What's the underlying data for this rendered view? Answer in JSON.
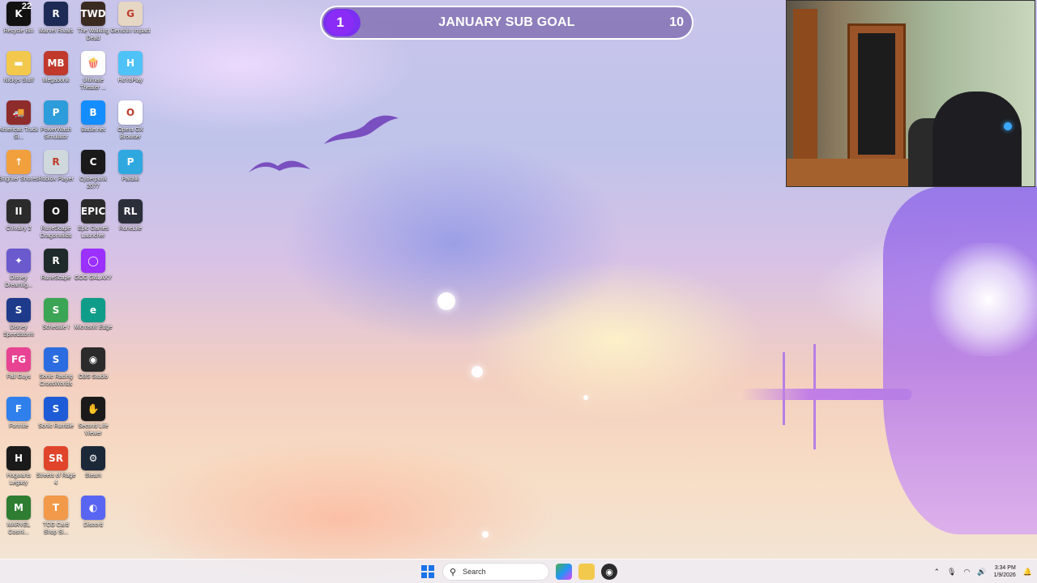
{
  "desktop": {
    "icons": [
      {
        "label": "Recycle Bin",
        "icon": "recycle-bin-icon",
        "glyph": "K",
        "badge": "22",
        "color": "#111111"
      },
      {
        "label": "Marvel Rivals",
        "icon": "marvel-rivals-icon",
        "glyph": "R",
        "color": "#1d2a55"
      },
      {
        "label": "The Walking Dead",
        "icon": "walking-dead-icon",
        "glyph": "TWD",
        "color": "#3b2a20"
      },
      {
        "label": "Genshin Impact",
        "icon": "genshin-impact-icon",
        "glyph": "G",
        "color": "#e6d7c4"
      },
      {
        "label": "Nickys Stuff",
        "icon": "folder-icon",
        "glyph": "▬",
        "color": "#f2c94c"
      },
      {
        "label": "Megabonk",
        "icon": "megabonk-icon",
        "glyph": "MB",
        "color": "#c0392b"
      },
      {
        "label": "Ultimate Theater ...",
        "icon": "popcorn-icon",
        "glyph": "🍿",
        "color": "#ffffff"
      },
      {
        "label": "HoYoPlay",
        "icon": "hoyoplay-icon",
        "glyph": "H",
        "color": "#4fc3f7"
      },
      {
        "label": "American Truck Si...",
        "icon": "truck-icon",
        "glyph": "🚚",
        "color": "#8e2b2b"
      },
      {
        "label": "PowerWash Simulator",
        "icon": "powerwash-icon",
        "glyph": "P",
        "color": "#2d9cdb"
      },
      {
        "label": "Battle.net",
        "icon": "battlenet-icon",
        "glyph": "B",
        "color": "#148eff"
      },
      {
        "label": "Opera GX Browser",
        "icon": "opera-gx-icon",
        "glyph": "O",
        "color": "#ffffff"
      },
      {
        "label": "Brighter Shores",
        "icon": "brighter-shores-icon",
        "glyph": "↑",
        "color": "#f2a03d"
      },
      {
        "label": "Roblox Player",
        "icon": "roblox-icon",
        "glyph": "R",
        "color": "#cfd8dc"
      },
      {
        "label": "Cyberpunk 2077",
        "icon": "cyberpunk-icon",
        "glyph": "C",
        "color": "#1a1a1a"
      },
      {
        "label": "Paltalk",
        "icon": "paltalk-icon",
        "glyph": "P",
        "color": "#2fa8e0"
      },
      {
        "label": "Chivalry 2",
        "icon": "chivalry-icon",
        "glyph": "II",
        "color": "#2b2b2b"
      },
      {
        "label": "RuneScape Dragonwilds",
        "icon": "dragonwilds-icon",
        "glyph": "O",
        "color": "#1a1a1a"
      },
      {
        "label": "Epic Games Launcher",
        "icon": "epic-games-icon",
        "glyph": "EPIC",
        "color": "#2a2a2a"
      },
      {
        "label": "RuneLite",
        "icon": "runelite-icon",
        "glyph": "RL",
        "color": "#2b2f3a"
      },
      {
        "label": "Disney Dreamlig...",
        "icon": "disney-icon",
        "glyph": "✦",
        "color": "#6a5acd"
      },
      {
        "label": "RuneScape",
        "icon": "runescape-icon",
        "glyph": "R",
        "color": "#1f2a2a"
      },
      {
        "label": "GOG GALAXY",
        "icon": "gog-galaxy-icon",
        "glyph": "◯",
        "color": "#9b30ff"
      },
      {
        "label": "",
        "icon": "",
        "glyph": "",
        "color": ""
      },
      {
        "label": "Disney Speedstorm",
        "icon": "speedstorm-icon",
        "glyph": "S",
        "color": "#1e3a8a"
      },
      {
        "label": "Schedule I",
        "icon": "schedule-icon",
        "glyph": "S",
        "color": "#3aa655"
      },
      {
        "label": "Microsoft Edge",
        "icon": "edge-icon",
        "glyph": "e",
        "color": "#0f9d8a"
      },
      {
        "label": "",
        "icon": "",
        "glyph": "",
        "color": ""
      },
      {
        "label": "Fall Guys",
        "icon": "fall-guys-icon",
        "glyph": "FG",
        "color": "#e84393"
      },
      {
        "label": "Sonic Racing CrossWorlds",
        "icon": "sonic-racing-icon",
        "glyph": "S",
        "color": "#2b6de0"
      },
      {
        "label": "OBS Studio",
        "icon": "obs-icon",
        "glyph": "◉",
        "color": "#2b2b2b"
      },
      {
        "label": "",
        "icon": "",
        "glyph": "",
        "color": ""
      },
      {
        "label": "Fortnite",
        "icon": "fortnite-icon",
        "glyph": "F",
        "color": "#2f80ed"
      },
      {
        "label": "Sonic Rumble",
        "icon": "sonic-rumble-icon",
        "glyph": "S",
        "color": "#1e5bd6"
      },
      {
        "label": "Second Life Viewer",
        "icon": "second-life-icon",
        "glyph": "✋",
        "color": "#1a1a1a"
      },
      {
        "label": "",
        "icon": "",
        "glyph": "",
        "color": ""
      },
      {
        "label": "Hogwarts Legacy",
        "icon": "hogwarts-icon",
        "glyph": "H",
        "color": "#1a1a1a"
      },
      {
        "label": "Streets of Rage 4",
        "icon": "streets-of-rage-icon",
        "glyph": "SR",
        "color": "#e0442b"
      },
      {
        "label": "Steam",
        "icon": "steam-icon",
        "glyph": "⚙",
        "color": "#1b2838"
      },
      {
        "label": "",
        "icon": "",
        "glyph": "",
        "color": ""
      },
      {
        "label": "MARVEL Cosmi...",
        "icon": "marvel-cosmic-icon",
        "glyph": "M",
        "color": "#2e7d32"
      },
      {
        "label": "TCG Card Shop Si...",
        "icon": "tcg-card-shop-icon",
        "glyph": "T",
        "color": "#f2994a"
      },
      {
        "label": "Discord",
        "icon": "discord-icon",
        "glyph": "◐",
        "color": "#5865f2"
      }
    ]
  },
  "sub_goal": {
    "current": "1",
    "title": "JANUARY SUB GOAL",
    "target": "10",
    "progress_fraction": 0.1,
    "accent": "#7b2ff0"
  },
  "taskbar": {
    "search_placeholder": "Search",
    "apps": [
      "copilot-icon",
      "file-explorer-icon",
      "obs-icon"
    ],
    "clock_time": "3:34 PM",
    "clock_date": "1/9/2026"
  }
}
